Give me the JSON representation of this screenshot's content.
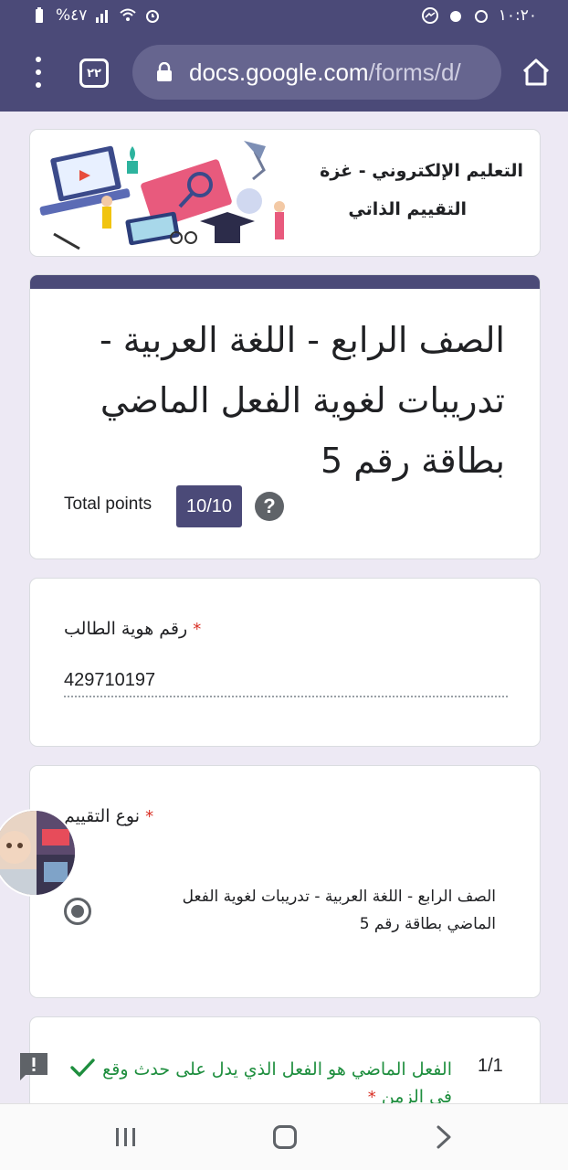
{
  "status_bar": {
    "battery": "%٤٧",
    "time": "١٠:٢٠"
  },
  "browser": {
    "tab_count": "٢٢",
    "url_host": "docs.google.com",
    "url_path": "/forms/d/"
  },
  "banner": {
    "title": "التعليم الإلكتروني - غزة",
    "subtitle": "التقييم الذاتي"
  },
  "form": {
    "title": "الصف الرابع - اللغة العربية - تدريبات لغوية الفعل الماضي بطاقة رقم 5",
    "total_points_label": "Total points",
    "score": "10/10",
    "help_glyph": "?"
  },
  "questions": {
    "student_id": {
      "label": "رقم هوية الطالب",
      "required_mark": "*",
      "value": "429710197"
    },
    "evaluation_type": {
      "label": "نوع التقييم",
      "required_mark": "*",
      "option": "الصف الرابع - اللغة العربية - تدريبات لغوية الفعل الماضي بطاقة رقم 5",
      "selected": true
    },
    "q1": {
      "score": "1/1",
      "text": "الفعل الماضي هو الفعل الذي يدل على حدث وقع في الزمن",
      "required_mark": "*",
      "correct": true
    }
  },
  "colors": {
    "theme": "#4b4a78",
    "correct": "#1e8e3e",
    "required": "#d93025"
  }
}
